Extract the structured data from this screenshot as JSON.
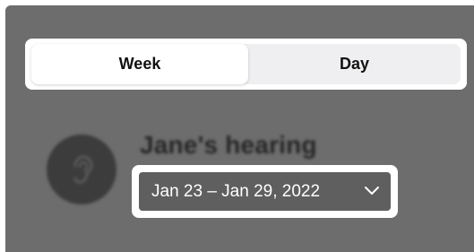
{
  "segmented_control": {
    "options": [
      {
        "label": "Week",
        "selected": true
      },
      {
        "label": "Day",
        "selected": false
      }
    ]
  },
  "profile": {
    "title": "Jane's hearing",
    "icon": "ear-icon"
  },
  "date_range": {
    "label": "Jan 23 – Jan 29, 2022",
    "icon": "chevron-down-icon"
  },
  "colors": {
    "overlay": "#6d6d6d",
    "highlight": "#ffffff",
    "pill": "#5f5f5f"
  }
}
